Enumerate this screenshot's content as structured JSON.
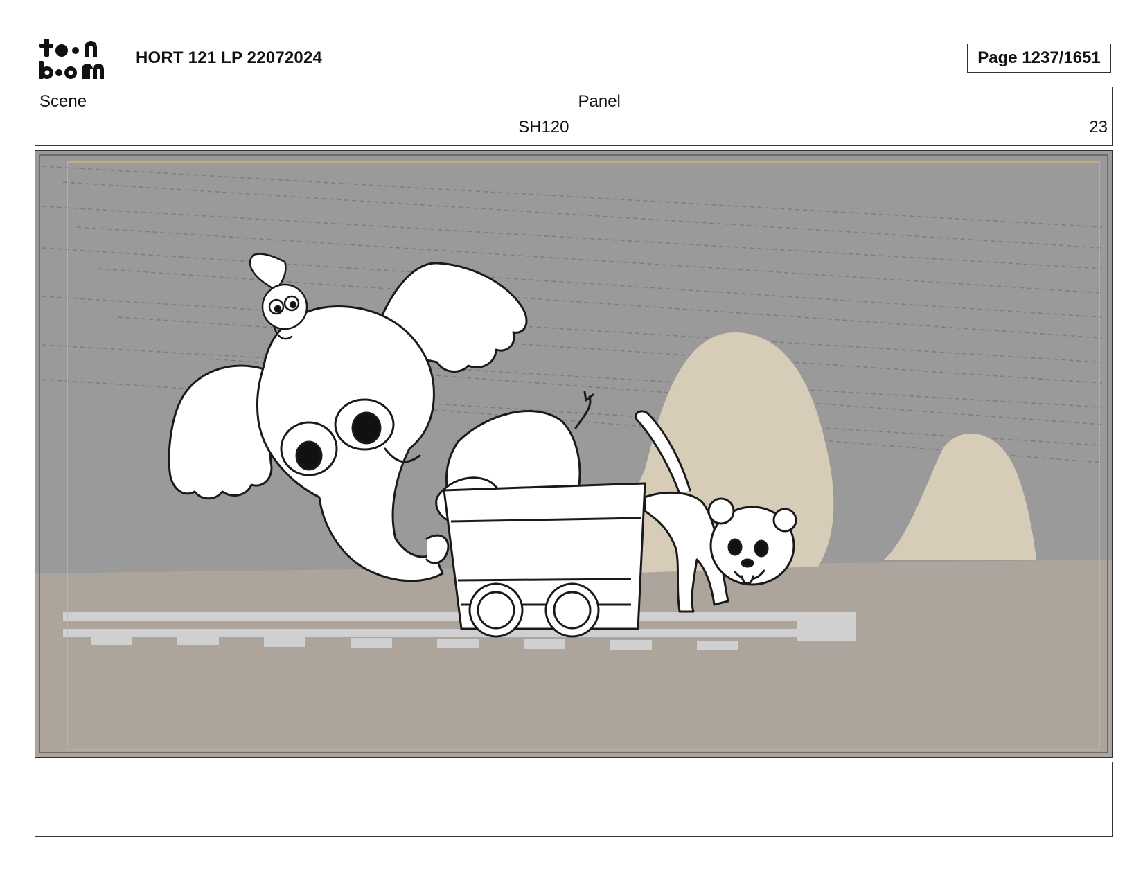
{
  "header": {
    "logo_alt": "toon boom",
    "title": "HORT 121 LP 22072024",
    "page_label": "Page 1237/1651"
  },
  "info": {
    "scene_label": "Scene",
    "scene_value": "SH120",
    "panel_label": "Panel",
    "panel_value": "23"
  },
  "panel": {
    "illustration": "storyboard-sketch",
    "colors": {
      "sky": "#9a9a9a",
      "ground": "#ada59b",
      "rock": "#d7ccb8",
      "rail": "#d0d0d0",
      "safe_frame": "#e0b070",
      "ink": "#1a1a1a"
    }
  },
  "caption": {
    "text": ""
  }
}
